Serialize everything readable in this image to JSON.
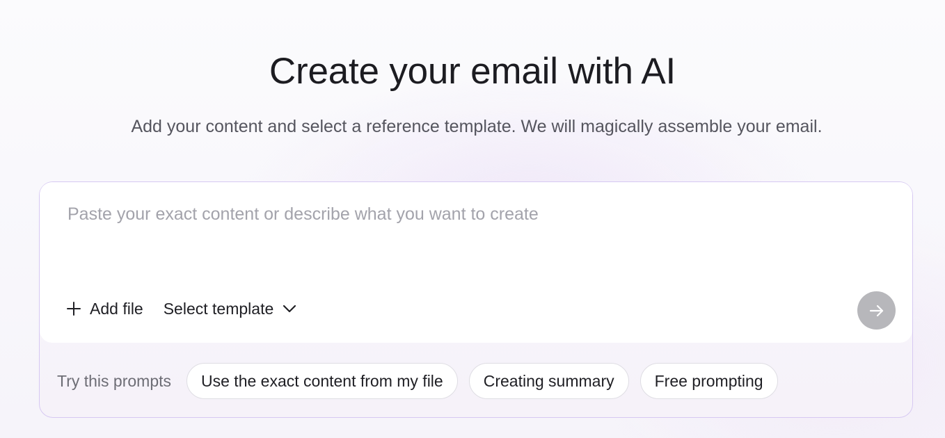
{
  "header": {
    "title": "Create your email with AI",
    "subtitle": "Add your content and select a reference template. We will magically assemble your email."
  },
  "composer": {
    "placeholder": "Paste your exact content or describe what you want to create",
    "value": "",
    "add_file_label": "Add file",
    "select_template_label": "Select template",
    "icons": {
      "add": "plus-icon",
      "dropdown": "chevron-down-icon",
      "send": "arrow-right-icon"
    }
  },
  "prompts": {
    "label": "Try this prompts",
    "chips": [
      {
        "label": "Use the exact content from my file"
      },
      {
        "label": "Creating summary"
      },
      {
        "label": "Free prompting"
      }
    ]
  },
  "colors": {
    "accent_border": "#d6c8f2",
    "send_button_disabled": "#b7b7bb",
    "title_text": "#1c1c21",
    "muted_text": "#6d6d75"
  }
}
